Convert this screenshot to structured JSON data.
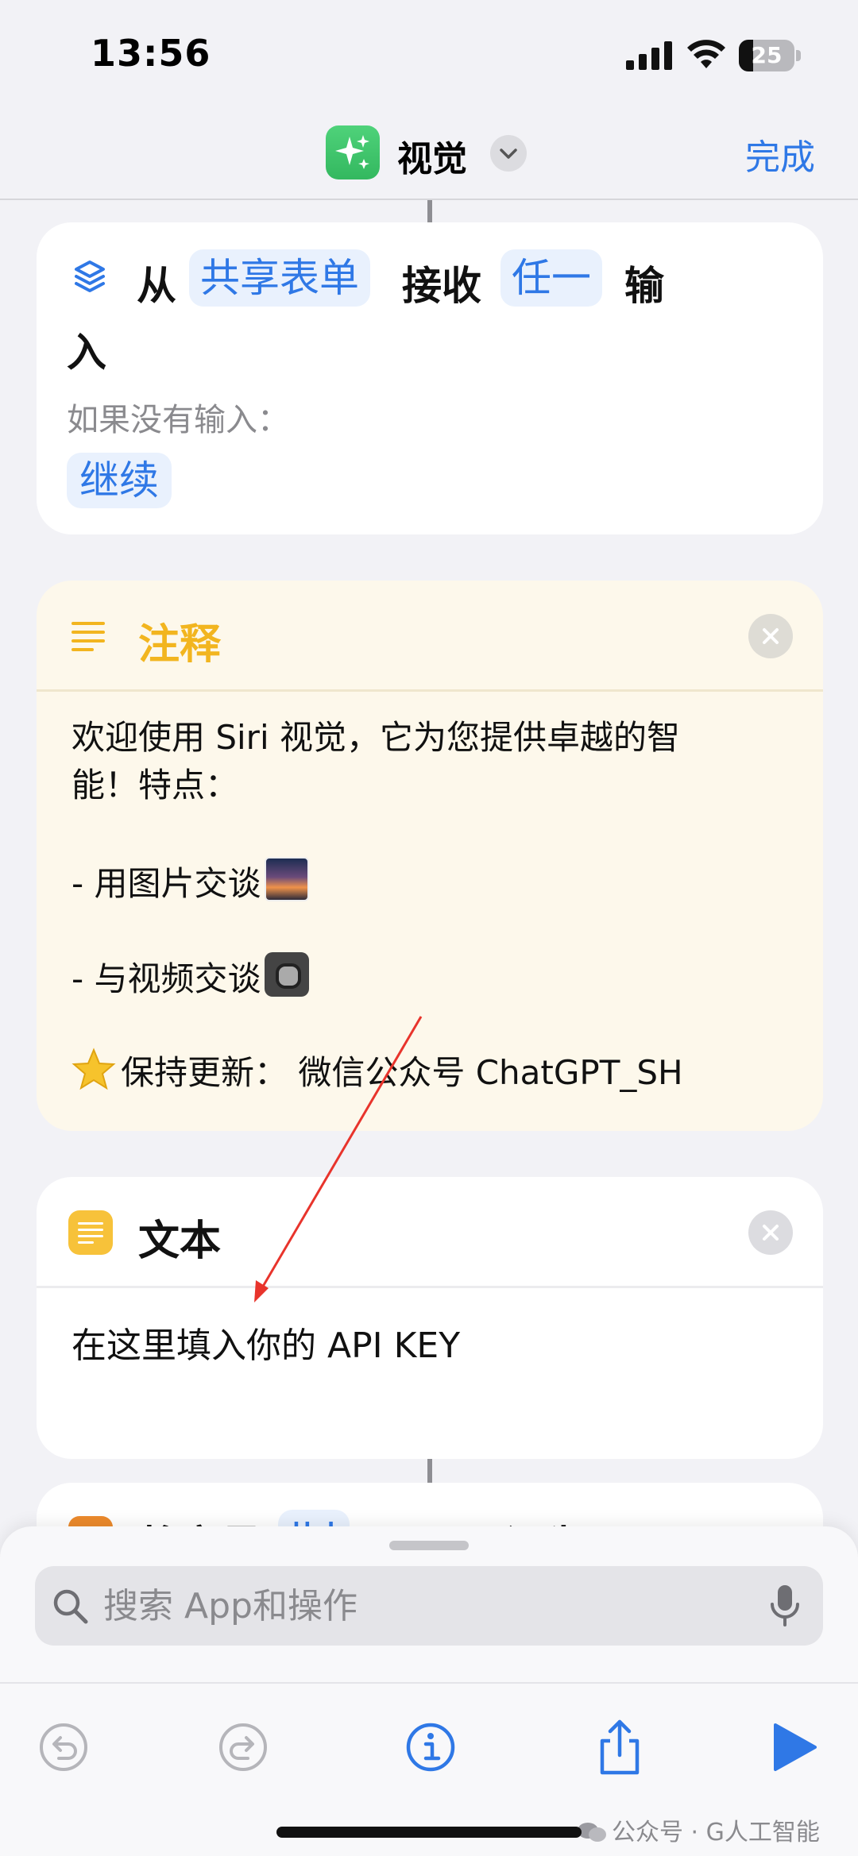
{
  "status_bar": {
    "time": "13:56",
    "battery": "25"
  },
  "nav": {
    "title": "视觉",
    "done_label": "完成",
    "app_icon": "sparkles-icon",
    "accent_color": "#2f78e6"
  },
  "receive_action": {
    "word_from": "从",
    "source_token": "共享表单",
    "word_receive": "接收",
    "type_token": "任一",
    "word_input_1": "输",
    "word_input_2": "入",
    "if_none_label": "如果没有输入：",
    "continue_token": "继续",
    "icon": "layers-icon"
  },
  "comment_action": {
    "title": "注释",
    "title_color": "#f2b51f",
    "icon": "lines-icon",
    "lines": [
      "欢迎使用 Siri 视觉，它为您提供卓越的智",
      "能！特点：",
      "",
      "- 用图片交谈",
      "",
      "- 与视频交谈",
      "",
      "保持更新：  微信公众号 ChatGPT_SH"
    ]
  },
  "text_action": {
    "title": "文本",
    "body": "在这里填入你的 API KEY",
    "icon": "text-doc-icon"
  },
  "variable_action": {
    "title": "将变量",
    "token": "ll        l",
    "tail": "设为"
  },
  "search": {
    "placeholder": "搜索 App和操作"
  },
  "watermark": "公众号 · G人工智能"
}
